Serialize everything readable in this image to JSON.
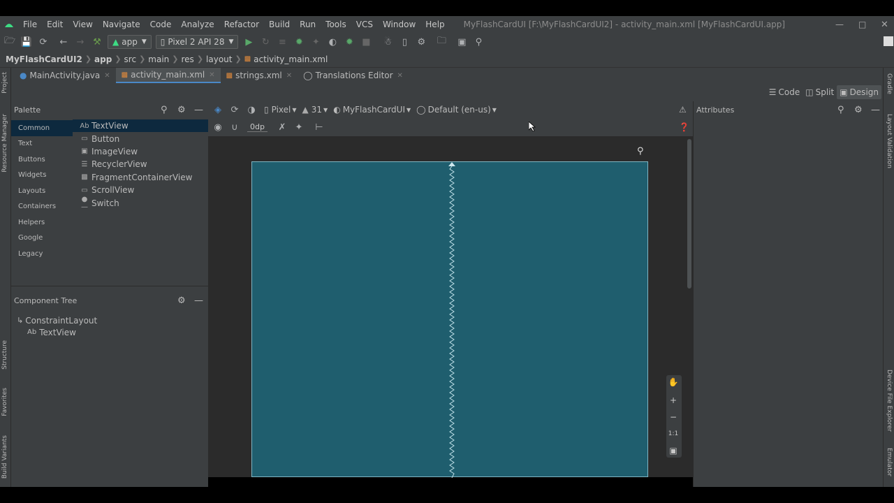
{
  "window_title": "MyFlashCardUI [F:\\MyFlashCardUI2] - activity_main.xml [MyFlashCardUI.app]",
  "menu": [
    "File",
    "Edit",
    "View",
    "Navigate",
    "Code",
    "Analyze",
    "Refactor",
    "Build",
    "Run",
    "Tools",
    "VCS",
    "Window",
    "Help"
  ],
  "toolbar": {
    "config": "app",
    "device": "Pixel 2 API 28"
  },
  "breadcrumb": [
    "MyFlashCardUI2",
    "app",
    "src",
    "main",
    "res",
    "layout",
    "activity_main.xml"
  ],
  "tabs": [
    {
      "label": "MainActivity.java"
    },
    {
      "label": "activity_main.xml"
    },
    {
      "label": "strings.xml"
    },
    {
      "label": "Translations Editor"
    }
  ],
  "view_modes": {
    "code": "Code",
    "split": "Split",
    "design": "Design"
  },
  "palette": {
    "title": "Palette",
    "categories": [
      "Common",
      "Text",
      "Buttons",
      "Widgets",
      "Layouts",
      "Containers",
      "Helpers",
      "Google",
      "Legacy"
    ],
    "items": [
      {
        "label": "TextView",
        "icon": "Ab"
      },
      {
        "label": "Button",
        "icon": "btn"
      },
      {
        "label": "ImageView",
        "icon": "img"
      },
      {
        "label": "RecyclerView",
        "icon": "list"
      },
      {
        "label": "FragmentContainerView",
        "icon": "frag"
      },
      {
        "label": "ScrollView",
        "icon": "scroll"
      },
      {
        "label": "Switch",
        "icon": "switch"
      }
    ]
  },
  "design_toolbar": {
    "device": "Pixel",
    "api": "31",
    "theme": "MyFlashCardUI",
    "locale": "Default (en-us)",
    "margin": "0dp"
  },
  "component_tree": {
    "title": "Component Tree",
    "root": "ConstraintLayout",
    "child": "TextView",
    "child_prefix": "Ab"
  },
  "attributes": {
    "title": "Attributes"
  },
  "zoom": {
    "fit": "1:1"
  },
  "side_left": {
    "project": "Project",
    "resource_manager": "Resource Manager",
    "structure": "Structure",
    "favorites": "Favorites",
    "build_variants": "Build Variants"
  },
  "side_right": {
    "gradle": "Gradle",
    "layout_validation": "Layout Validation",
    "device_file_explorer": "Device File Explorer",
    "emulator": "Emulator"
  },
  "colors": {
    "blueprint": "#1f5e6e",
    "selection": "#0d293e",
    "accent": "#4a88c7"
  }
}
